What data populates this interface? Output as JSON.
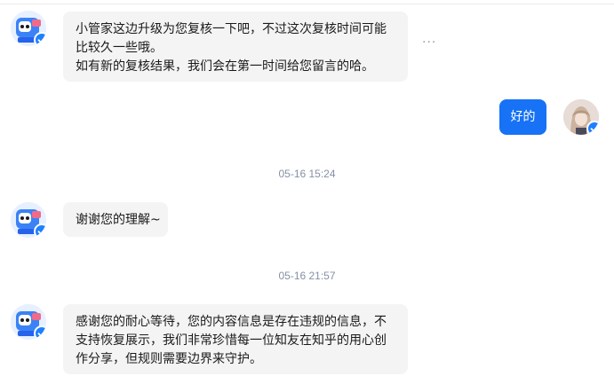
{
  "messages": [
    {
      "sender": "bot",
      "lines": [
        "小管家这边升级为您复核一下吧，不过这次复核时间可能",
        "比较久一些哦。",
        "如有新的复核结果，我们会在第一时间给您留言的哈。"
      ]
    },
    {
      "sender": "me",
      "text": "好的"
    },
    {
      "timestamp": "05-16 15:24"
    },
    {
      "sender": "bot",
      "lines": [
        "谢谢您的理解~"
      ]
    },
    {
      "timestamp": "05-16 21:57"
    },
    {
      "sender": "bot",
      "lines": [
        "感谢您的耐心等待，您的内容信息是存在违规的信息，不",
        "支持恢复展示，我们非常珍惜每一位知友在知乎的用心创",
        "作分享，但规则需要边界来守护。"
      ]
    }
  ],
  "more_options_glyph": "···",
  "colors": {
    "my_bubble": "#1772f6",
    "bot_bubble": "#f4f4f4",
    "verified_badge": "#1e80ff",
    "timestamp_text": "#8590a6"
  }
}
